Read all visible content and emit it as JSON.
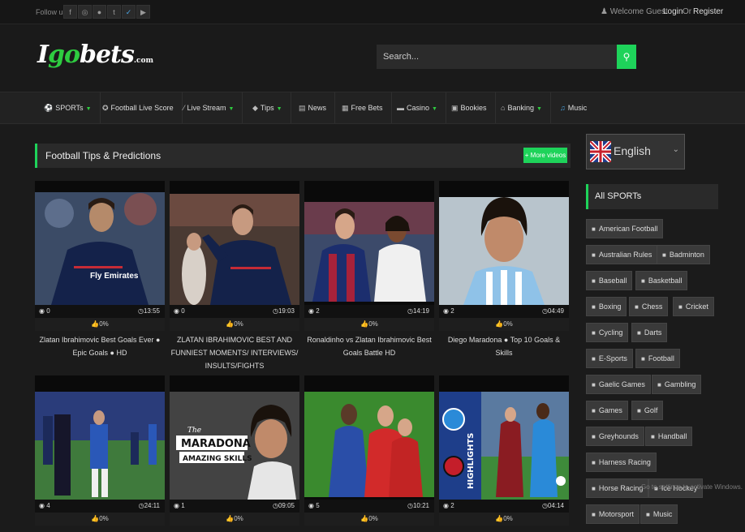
{
  "topbar": {
    "follow_label": "Follow us",
    "social_icons": [
      "facebook-icon",
      "instagram-icon",
      "reddit-icon",
      "tumblr-icon",
      "twitter-icon",
      "youtube-icon"
    ],
    "welcome": "Welcome Guest",
    "login": "Login",
    "or": "Or",
    "register": "Register"
  },
  "header": {
    "logo_main_1": "I",
    "logo_main_2": "go",
    "logo_main_3": "bets",
    "logo_tld": ".com",
    "search_placeholder": "Search..."
  },
  "nav": {
    "items": [
      {
        "label": "SPORTs",
        "icon": "ball-icon",
        "dropdown": true
      },
      {
        "label": "Football Live Score",
        "icon": "soccer-icon",
        "dropdown": false
      },
      {
        "label": "Live Stream",
        "icon": "stream-icon",
        "dropdown": true
      },
      {
        "label": "Tips",
        "icon": "tag-icon",
        "dropdown": true
      },
      {
        "label": "News",
        "icon": "news-icon",
        "dropdown": false
      },
      {
        "label": "Free Bets",
        "icon": "gift-icon",
        "dropdown": false
      },
      {
        "label": "Casino",
        "icon": "casino-icon",
        "dropdown": true
      },
      {
        "label": "Bookies",
        "icon": "book-icon",
        "dropdown": false
      },
      {
        "label": "Banking",
        "icon": "bank-icon",
        "dropdown": true
      },
      {
        "label": "Music",
        "icon": "music-icon",
        "dropdown": false
      }
    ]
  },
  "main": {
    "section_title": "Football Tips & Predictions",
    "more_videos": "More videos",
    "videos": [
      {
        "views": "0",
        "duration": "13:55",
        "likes": "0%",
        "title": "Zlatan Ibrahimovic Best Goals Ever ● Epic Goals ● HD"
      },
      {
        "views": "0",
        "duration": "19:03",
        "likes": "0%",
        "title": "ZLATAN IBRAHIMOVIC BEST AND FUNNIEST MOMENTS/ INTERVIEWS/ INSULTS/FIGHTS"
      },
      {
        "views": "2",
        "duration": "14:19",
        "likes": "0%",
        "title": "Ronaldinho vs Zlatan Ibrahimovic Best Goals Battle HD"
      },
      {
        "views": "2",
        "duration": "04:49",
        "likes": "0%",
        "title": "Diego Maradona ● Top 10 Goals & Skills"
      },
      {
        "views": "4",
        "duration": "24:11",
        "likes": "0%",
        "title": ""
      },
      {
        "views": "1",
        "duration": "09:05",
        "likes": "0%",
        "title": ""
      },
      {
        "views": "5",
        "duration": "10:21",
        "likes": "0%",
        "title": ""
      },
      {
        "views": "2",
        "duration": "04:14",
        "likes": "0%",
        "title": ""
      }
    ],
    "thumb_text": {
      "fly_emirates": "Fly Emirates",
      "the": "The",
      "maradona": "MARADONA",
      "amazing_skills": "AMAZING SKILLS",
      "highlights": "HIGHLIGHTS"
    }
  },
  "sidebar": {
    "language": "English",
    "sports_title": "All SPORTs",
    "sports": [
      "American Football",
      "Australian Rules",
      "Badminton",
      "Baseball",
      "Basketball",
      "Boxing",
      "Chess",
      "Cricket",
      "Cycling",
      "Darts",
      "E-Sports",
      "Football",
      "Gaelic Games",
      "Gambling",
      "Games",
      "Golf",
      "Greyhounds",
      "Handball",
      "Harness Racing",
      "Horse Racing",
      "Ice Hockey",
      "Motorsport",
      "Music"
    ]
  },
  "overlay": {
    "line1": "Go to settings to activate Windows."
  },
  "colors": {
    "accent": "#1ed35a",
    "background": "#1b1b1b"
  }
}
